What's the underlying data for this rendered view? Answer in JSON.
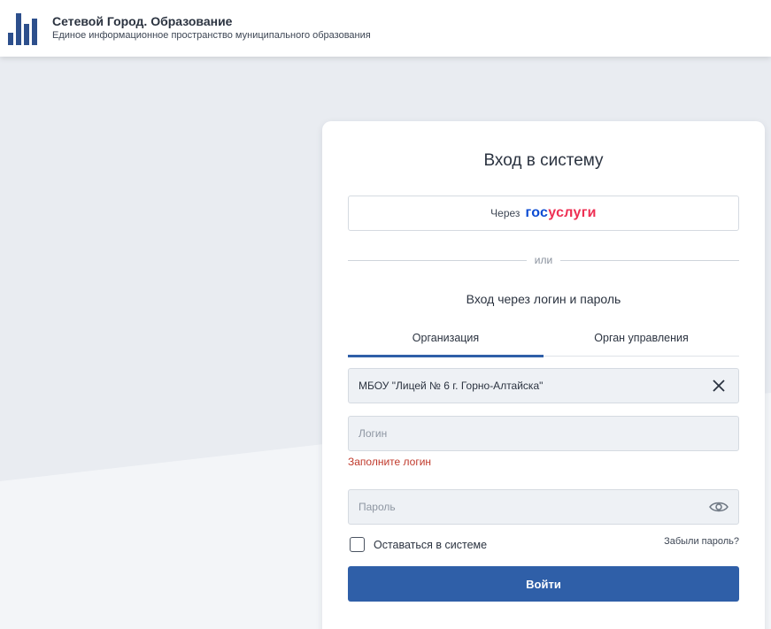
{
  "header": {
    "title": "Сетевой Город. Образование",
    "subtitle": "Единое информационное пространство муниципального образования"
  },
  "login": {
    "title": "Вход в систему",
    "gosuslugi": {
      "via_label": "Через",
      "logo_part1": "гос",
      "logo_part2": "услуги"
    },
    "divider_text": "или",
    "subtitle": "Вход через логин и пароль",
    "tabs": [
      {
        "label": "Организация",
        "active": true
      },
      {
        "label": "Орган управления",
        "active": false
      }
    ],
    "organization_value": "МБОУ \"Лицей № 6 г. Горно-Алтайска\"",
    "login_placeholder": "Логин",
    "login_value": "",
    "login_error": "Заполните логин",
    "password_placeholder": "Пароль",
    "password_value": "",
    "remember_label": "Оставаться в системе",
    "remember_checked": false,
    "forgot_label": "Забыли пароль?",
    "submit_label": "Войти"
  },
  "colors": {
    "primary": "#2f5fa8",
    "error": "#c0392b",
    "gos_blue": "#0d4cd3",
    "gos_red": "#ee2f53",
    "background": "#e8ebf0"
  },
  "icons": {
    "logo": "city-bars-logo-icon",
    "clear": "close-icon",
    "show_password": "eye-icon"
  }
}
